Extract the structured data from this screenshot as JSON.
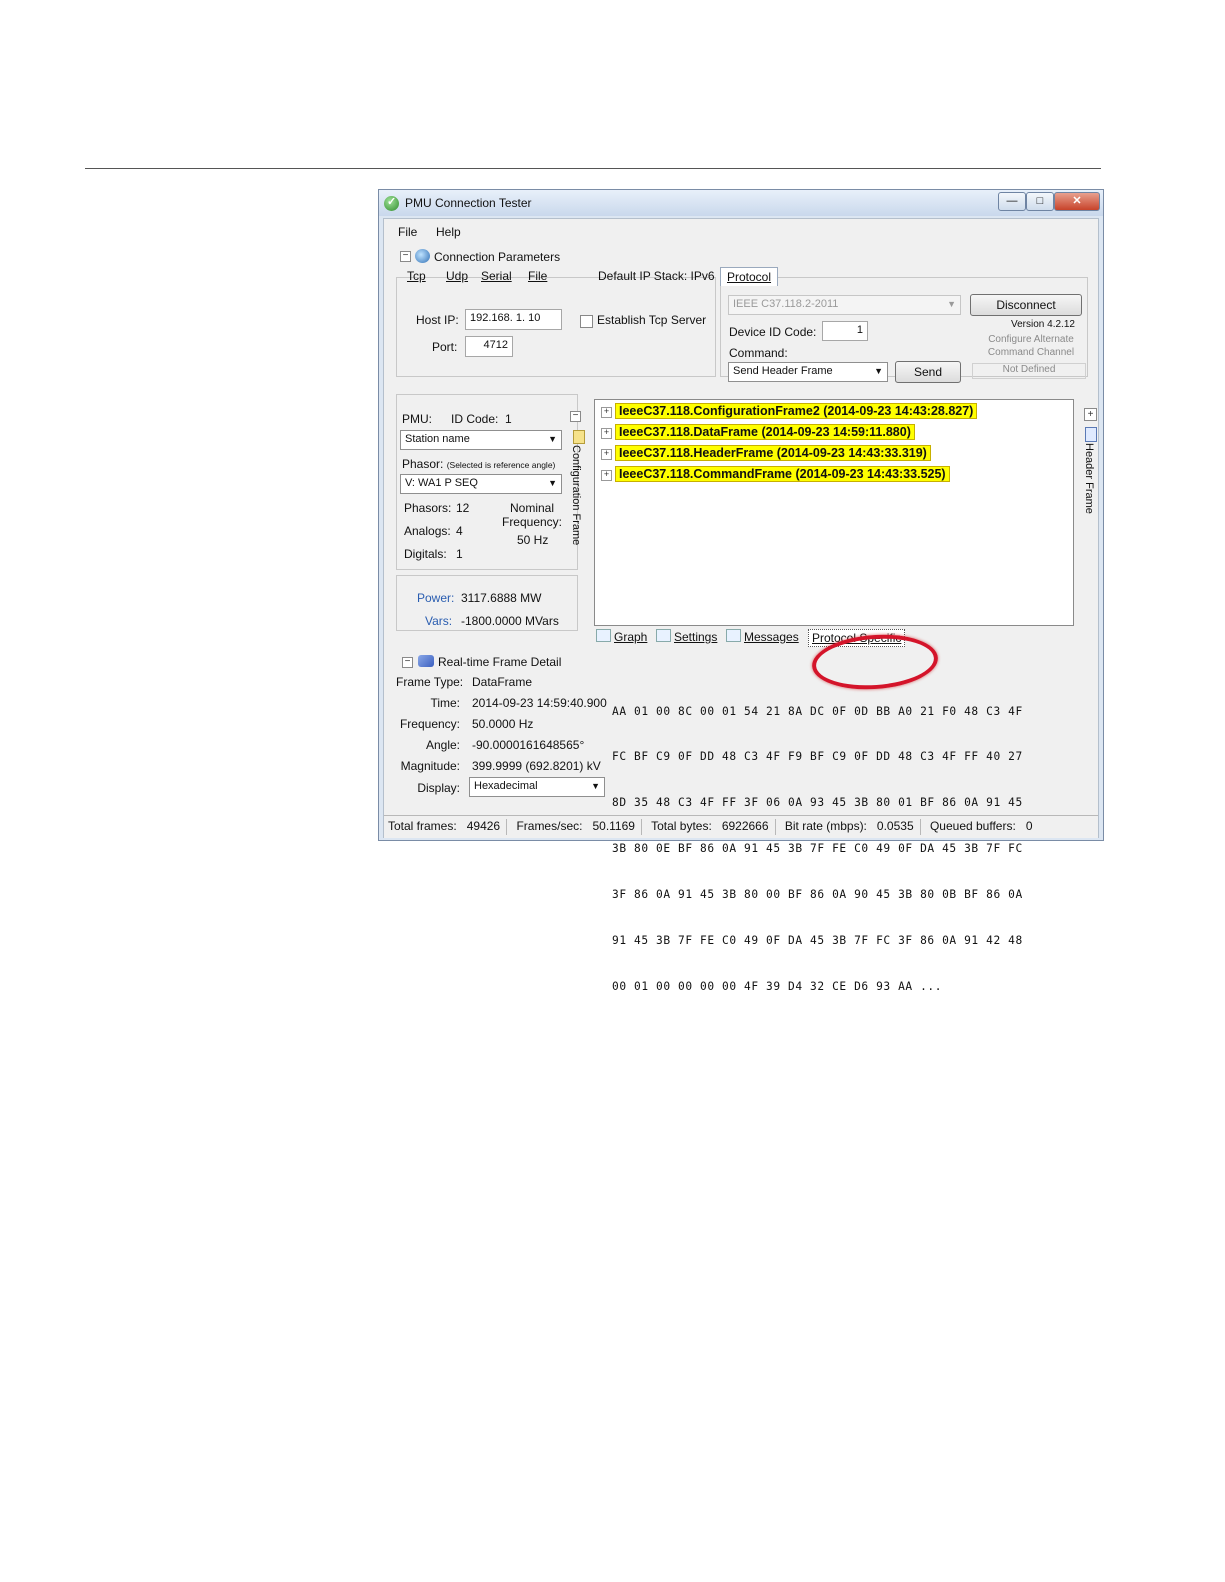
{
  "window": {
    "title": "PMU Connection Tester",
    "controls": {
      "minimize": "—",
      "maximize": "□",
      "close": "✕"
    }
  },
  "menu": [
    "File",
    "Help"
  ],
  "connection": {
    "header": "Connection Parameters",
    "tabs": [
      "Tcp",
      "Udp",
      "Serial",
      "File"
    ],
    "default_stack": "Default IP Stack: IPv6",
    "host_ip_label": "Host IP:",
    "host_ip": "192.168.   1.  10",
    "port_label": "Port:",
    "port": "4712",
    "establish_server": "Establish Tcp Server"
  },
  "protocol": {
    "tab": "Protocol",
    "selected": "IEEE C37.118.2-2011",
    "device_id_label": "Device ID Code:",
    "device_id": "1",
    "command_label": "Command:",
    "command": "Send Header Frame",
    "send": "Send",
    "disconnect": "Disconnect",
    "version": "Version 4.2.12",
    "alt_channel": "Configure Alternate Command Channel",
    "not_defined": "Not Defined"
  },
  "pmu": {
    "pmu_label": "PMU:",
    "id_code_label": "ID Code:",
    "id_code": "1",
    "station": "Station name",
    "phasor_label": "Phasor:",
    "phasor_note": "(Selected is reference angle)",
    "phasor": "V: WA1 P SEQ",
    "phasors_label": "Phasors:",
    "phasors": "12",
    "analogs_label": "Analogs:",
    "analogs": "4",
    "digitals_label": "Digitals:",
    "digitals": "1",
    "nominal_label": "Nominal Frequency:",
    "nominal_value": "50 Hz",
    "config_frame_vertical": "Configuration Frame"
  },
  "power": {
    "power_label": "Power:",
    "power": "3117.6888 MW",
    "vars_label": "Vars:",
    "vars": "-1800.0000 MVars"
  },
  "frames": [
    "IeeeC37.118.ConfigurationFrame2 (2014-09-23 14:43:28.827)",
    "IeeeC37.118.DataFrame (2014-09-23 14:59:11.880)",
    "IeeeC37.118.HeaderFrame (2014-09-23 14:43:33.319)",
    "IeeeC37.118.CommandFrame (2014-09-23 14:43:33.525)"
  ],
  "header_frame_vertical": "Header Frame",
  "bottom_tabs": [
    "Graph",
    "Settings",
    "Messages",
    "Protocol Specific"
  ],
  "realtime": {
    "header": "Real-time Frame Detail",
    "frame_type_label": "Frame Type:",
    "frame_type": "DataFrame",
    "time_label": "Time:",
    "time": "2014-09-23 14:59:40.900",
    "frequency_label": "Frequency:",
    "frequency": "50.0000 Hz",
    "angle_label": "Angle:",
    "angle": "-90.0000161648565°",
    "magnitude_label": "Magnitude:",
    "magnitude": "399.9999 (692.8201) kV",
    "display_label": "Display:",
    "display": "Hexadecimal",
    "hex": [
      "AA 01 00 8C 00 01 54 21 8A DC 0F 0D BB A0 21 F0 48 C3 4F",
      "FC BF C9 0F DD 48 C3 4F F9 BF C9 0F DD 48 C3 4F FF 40 27",
      "8D 35 48 C3 4F FF 3F 06 0A 93 45 3B 80 01 BF 86 0A 91 45",
      "3B 80 0E BF 86 0A 91 45 3B 7F FE C0 49 0F DA 45 3B 7F FC",
      "3F 86 0A 91 45 3B 80 00 BF 86 0A 90 45 3B 80 0B BF 86 0A",
      "91 45 3B 7F FE C0 49 0F DA 45 3B 7F FC 3F 86 0A 91 42 48",
      "00 01 00 00 00 00 4F 39 D4 32 CE D6 93 AA ..."
    ]
  },
  "status": {
    "total_frames_label": "Total frames:",
    "total_frames": "49426",
    "fps_label": "Frames/sec:",
    "fps": "50.1169",
    "bytes_label": "Total bytes:",
    "bytes": "6922666",
    "bitrate_label": "Bit rate (mbps):",
    "bitrate": "0.0535",
    "queued_label": "Queued buffers:",
    "queued": "0"
  },
  "colors": {
    "frame_highlight": "#ffff00",
    "callout_oval": "#d4142a",
    "label_blue": "#2a5db0"
  }
}
